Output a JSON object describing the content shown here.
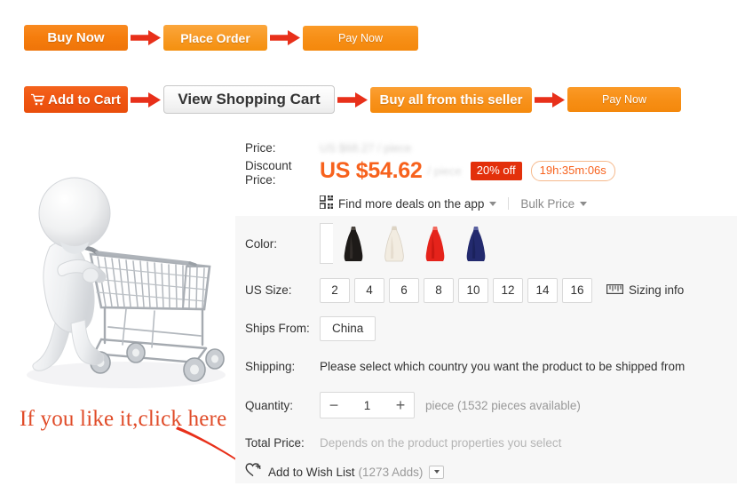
{
  "flow_rows": [
    {
      "name": "checkout-flow-direct",
      "steps": [
        {
          "label": "Buy Now",
          "style": "btn-buy-now",
          "icon": null
        },
        {
          "label": "Place Order",
          "style": "btn-place-order",
          "icon": null
        },
        {
          "label": "Pay Now",
          "style": "btn-pay-now-1",
          "icon": null
        }
      ]
    },
    {
      "name": "checkout-flow-cart",
      "steps": [
        {
          "label": "Add to Cart",
          "style": "btn-add-cart",
          "icon": "cart-icon"
        },
        {
          "label": "View Shopping Cart",
          "style": "btn-view-cart",
          "icon": null
        },
        {
          "label": "Buy all from this seller",
          "style": "btn-buy-all",
          "icon": null
        },
        {
          "label": "Pay Now",
          "style": "btn-pay-now-2",
          "icon": null
        }
      ]
    }
  ],
  "annotation": {
    "text": "If you like it,click here",
    "color": "#e04b28",
    "arrow_color": "#e8301a"
  },
  "product": {
    "image_alt": "3d-figure-pushing-shopping-cart"
  },
  "price": {
    "label": "Price:",
    "original": "US $68.27 / piece",
    "discount_label": "Discount Price:",
    "discount_label_line1": "Discount",
    "discount_label_line2": "Price:",
    "amount": "US $54.62",
    "unit": "/ piece",
    "discount_badge": "20% off",
    "timer": "19h:35m:06s",
    "badge_color": "#e3300b",
    "accent_color": "#f7621d"
  },
  "app_promo": {
    "icon": "qr-code-icon",
    "label": "Find more deals on the app",
    "bulk_price_label": "Bulk Price"
  },
  "options": {
    "color": {
      "label": "Color:",
      "swatches": [
        {
          "name": "black",
          "hex": "#1d1a18"
        },
        {
          "name": "white",
          "hex": "#f2ece1"
        },
        {
          "name": "red",
          "hex": "#e5231b"
        },
        {
          "name": "navy",
          "hex": "#232a6e"
        }
      ]
    },
    "us_size": {
      "label": "US Size:",
      "values": [
        "2",
        "4",
        "6",
        "8",
        "10",
        "12",
        "14",
        "16"
      ],
      "sizing_info_label": "Sizing info",
      "sizing_info_icon": "ruler-icon"
    },
    "ships_from": {
      "label": "Ships From:",
      "value": "China"
    },
    "shipping": {
      "label": "Shipping:",
      "message": "Please select which country you want the product to be shipped from"
    },
    "quantity": {
      "label": "Quantity:",
      "value": "1",
      "minus": "−",
      "plus": "+",
      "note": "piece (1532 pieces available)"
    },
    "total_price": {
      "label": "Total Price:",
      "note": "Depends on the product properties you select"
    },
    "wish_list": {
      "icon": "heart-plus-icon",
      "label": "Add to Wish List",
      "count": "(1273 Adds)"
    }
  }
}
